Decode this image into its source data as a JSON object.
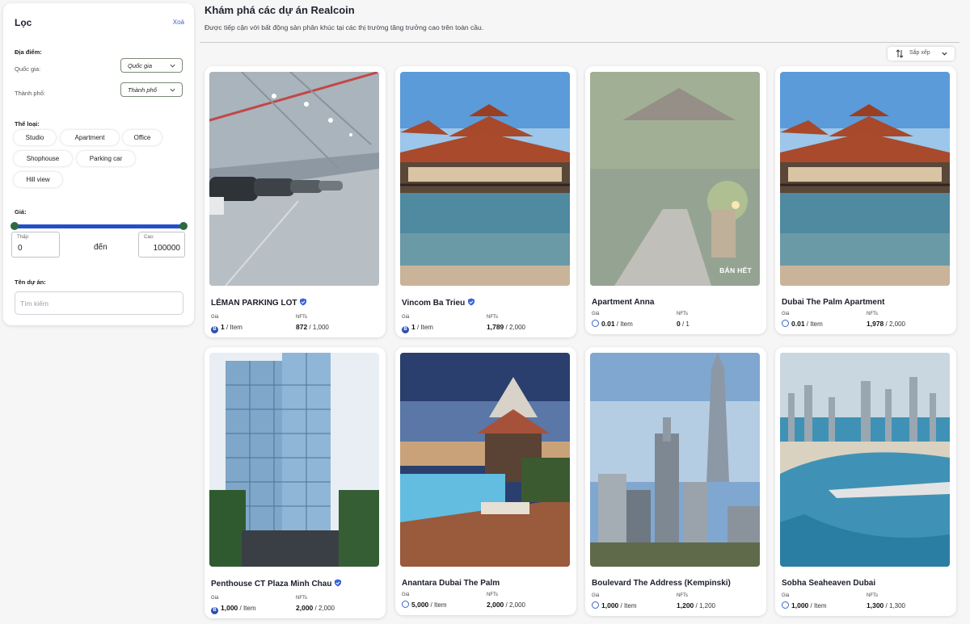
{
  "filter": {
    "title": "Lọc",
    "clear": "Xoá",
    "location_label": "Địa điểm:",
    "country_label": "Quốc gia:",
    "country_value": "Quốc gia",
    "city_label": "Thành phố:",
    "city_value": "Thành phố",
    "category_label": "Thể loại:",
    "categories": [
      "Studio",
      "Apartment",
      "Office",
      "Shophouse",
      "Parking car",
      "Hill view"
    ],
    "price_label": "Giá:",
    "price_low_caption": "Thấp:",
    "price_low": "0",
    "price_to": "đến",
    "price_high_caption": "Cao:",
    "price_high": "100000",
    "project_label": "Tên dự án:",
    "search_placeholder": "Tìm kiếm"
  },
  "header": {
    "title": "Khám phá các dự án Realcoin",
    "subtitle": "Được tiếp cận với bất động sản phân khúc tại các thị trường tăng trưởng cao trên toàn cầu.",
    "sort_label": "Sắp xếp"
  },
  "card_labels": {
    "price": "Giá",
    "nfts": "NFTs",
    "per_item": " / Item"
  },
  "cards": [
    {
      "name": "LÉMAN PARKING LOT",
      "price": "1",
      "nfts_sold": "872",
      "nfts_total": " / 1,000",
      "verified": true,
      "coin": "B"
    },
    {
      "name": "Vincom Ba Trieu",
      "price": "1",
      "nfts_sold": "1,789",
      "nfts_total": " / 2,000",
      "verified": true,
      "coin": "B"
    },
    {
      "name": "Apartment Anna",
      "price": "0.01",
      "nfts_sold": "0",
      "nfts_total": " / 1",
      "verified": false,
      "coin": "C",
      "badge": "BÁN HẾT"
    },
    {
      "name": "Dubai The Palm Apartment",
      "price": "0.01",
      "nfts_sold": "1,978",
      "nfts_total": " / 2,000",
      "verified": false,
      "coin": "C"
    },
    {
      "name": "Penthouse CT Plaza Minh Chau",
      "price": "1,000",
      "nfts_sold": "2,000",
      "nfts_total": " / 2,000",
      "verified": true,
      "coin": "B"
    },
    {
      "name": "Anantara Dubai The Palm",
      "price": "5,000",
      "nfts_sold": "2,000",
      "nfts_total": " / 2,000",
      "verified": false,
      "coin": "C"
    },
    {
      "name": "Boulevard The Address (Kempinski)",
      "price": "1,000",
      "nfts_sold": "1,200",
      "nfts_total": " / 1,200",
      "verified": false,
      "coin": "C"
    },
    {
      "name": "Sobha Seaheaven Dubai",
      "price": "1,000",
      "nfts_sold": "1,300",
      "nfts_total": " / 1,300",
      "verified": false,
      "coin": "C"
    }
  ]
}
